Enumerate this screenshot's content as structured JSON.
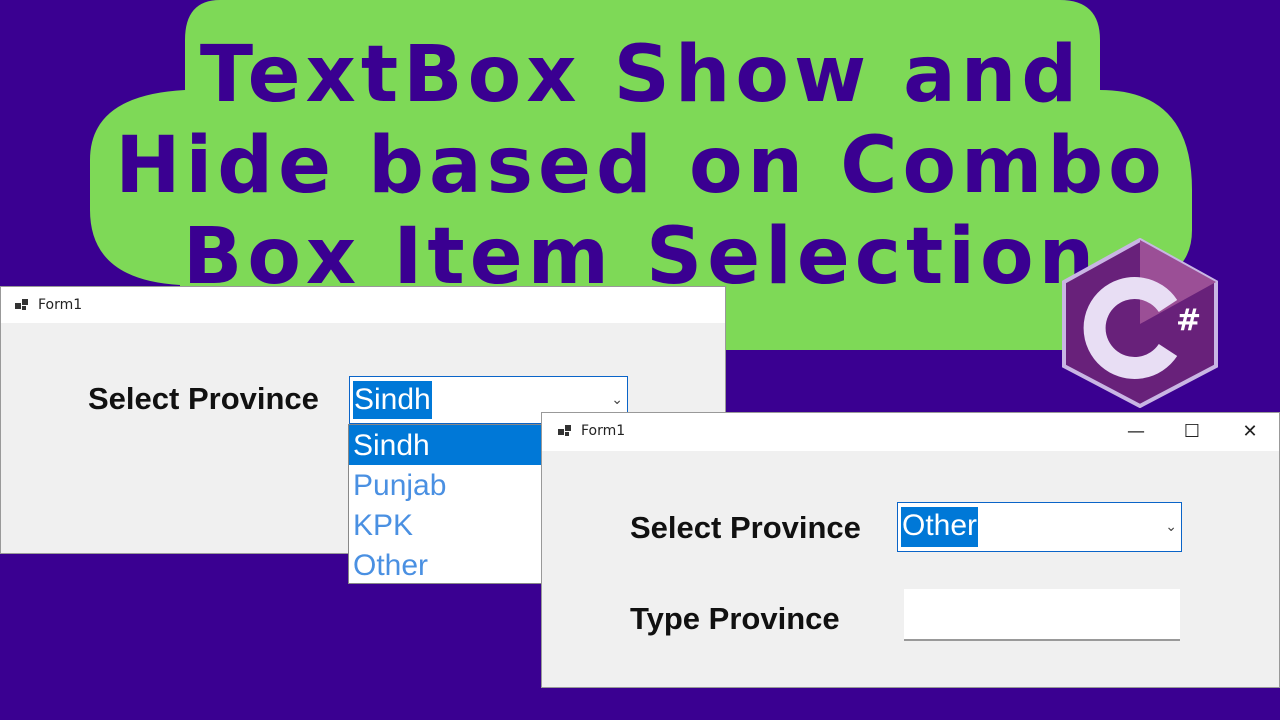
{
  "banner": {
    "title_line1": "TextBox Show and",
    "title_line2": "Hide based on Combo",
    "title_line3": "Box Item Selection",
    "bg_color": "#7ed957",
    "text_color": "#3a0091"
  },
  "background_color": "#3a0091",
  "logo": {
    "text": "#",
    "icon": "csharp-logo"
  },
  "form_left": {
    "title": "Form1",
    "select_label": "Select Province",
    "combo_value": "Sindh",
    "options": [
      "Sindh",
      "Punjab",
      "KPK",
      "Other"
    ],
    "highlighted_option": "Sindh"
  },
  "form_right": {
    "title": "Form1",
    "select_label": "Select Province",
    "combo_value": "Other",
    "type_label": "Type Province",
    "textbox_value": "",
    "controls": {
      "minimize": "—",
      "maximize": "☐",
      "close": "✕"
    }
  }
}
